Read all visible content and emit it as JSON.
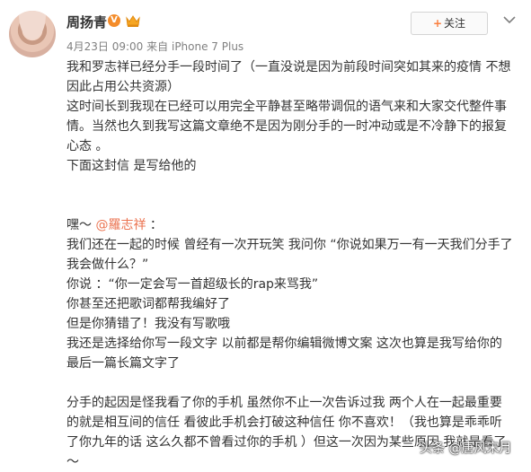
{
  "post": {
    "username": "周扬青",
    "verified_badge": "V",
    "timestamp": "4月23日 09:00",
    "source_prefix": "来自",
    "source": "iPhone 7 Plus",
    "follow_label": "关注",
    "icons": [
      "avatar",
      "verified-icon",
      "crown-icon",
      "more-chevron-icon"
    ]
  },
  "body": {
    "lines": [
      "我和罗志祥已经分手一段时间了（一直没说是因为前段时间突如其来的疫情 不想",
      "因此占用公共资源）",
      "这时间长到我现在已经可以用完全平静甚至略带调侃的语气来和大家交代整件事",
      "情。当然也久到我写这篇文章绝不是因为刚分手的一时冲动或是不冷静下的报复",
      "心态 。",
      "下面这封信 是写给他的",
      "",
      "",
      "",
      "我们还在一起的时候 曾经有一次开玩笑 我问你 “你说如果万一有一天我们分手了",
      "我会做什么？”",
      "你说 ：“你一定会写一首超级长的rap来骂我”",
      "你甚至还把歌词都帮我编好了",
      "但是你猜错了！我没有写歌哦",
      "我还是选择给你写一段文字  以前都是帮你编辑微博文案 这次也算是我写给你的",
      "最后一篇长篇文字了",
      "",
      "分手的起因是怪我看了你的手机  虽然你不止一次告诉过我  两个人在一起最重要",
      "的就是相互间的信任  看彼此手机会打破这种信任 你不喜欢！（我也算是乖乖听",
      "了你九年的话  这么久都不曾看过你的手机 ）但这一次因为某些原因  我就是看了",
      "～"
    ],
    "greeting_prefix": "嘿～ ",
    "mention": "@羅志祥",
    "greeting_suffix": " ："
  },
  "watermark": "头条 @唐风宋月"
}
